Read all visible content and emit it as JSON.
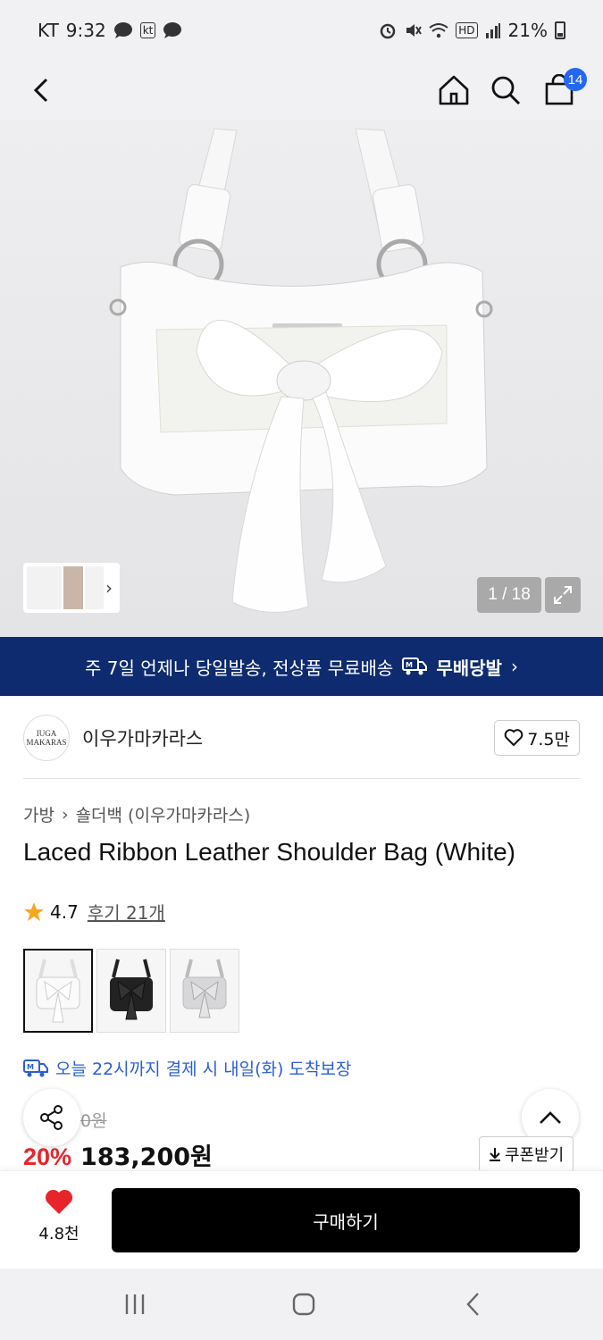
{
  "status": {
    "carrier": "KT",
    "time": "9:32",
    "kt_badge": "kt",
    "hd": "HD",
    "battery": "21%"
  },
  "header": {
    "cart_count": "14"
  },
  "gallery": {
    "counter": "1 / 18"
  },
  "banner": {
    "text": "주 7일 언제나 당일발송, 전상품 무료배송",
    "brand": "무배당발"
  },
  "brand": {
    "logo_line1": "IUGA",
    "logo_line2": "MAKARAS",
    "name": "이우가마카라스",
    "likes": "7.5만"
  },
  "product": {
    "breadcrumb_category": "가방",
    "breadcrumb_sub": "숄더백 (이우가마카라스)",
    "title": "Laced Ribbon Leather Shoulder Bag (White)",
    "rating": "4.7",
    "reviews": "후기 21개",
    "delivery": "오늘 22시까지 결제 시 내일(화) 도착보장",
    "original_price": "0원",
    "discount": "20%",
    "price": "183,200원"
  },
  "actions": {
    "coupon": "쿠폰받기",
    "wish_count": "4.8천",
    "buy": "구매하기"
  },
  "colors": {
    "accent_blue": "#2468f2",
    "banner_bg": "#0d2b6e",
    "discount_red": "#e8242b",
    "heart_red": "#e8242b"
  }
}
